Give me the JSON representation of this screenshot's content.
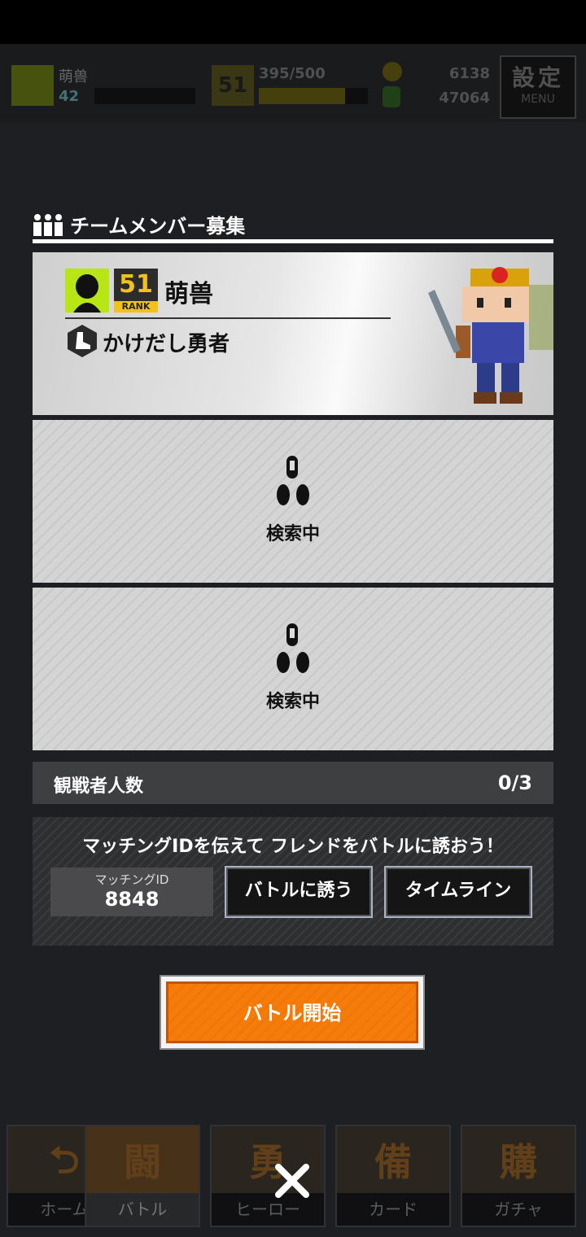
{
  "topbar": {
    "player_name": "萌兽",
    "level": "42",
    "rank": "51",
    "rank_label": "RANK",
    "exp_text": "395/500",
    "exp_fraction": 0.79,
    "coins": "6138",
    "gems": "47064",
    "settings_label": "設定",
    "settings_sub": "MENU"
  },
  "panel": {
    "title": "チームメンバー募集"
  },
  "leader": {
    "rank": "51",
    "rank_label": "RANK",
    "name": "萌兽",
    "title": "かけだし勇者"
  },
  "slots": [
    {
      "status": "検索中"
    },
    {
      "status": "検索中"
    }
  ],
  "spectators": {
    "label": "観戦者人数",
    "count": "0/3"
  },
  "invite": {
    "message": "マッチングIDを伝えて フレンドをバトルに誘おう！",
    "id_label": "マッチングID",
    "id_value": "8848",
    "invite_button": "バトルに誘う",
    "timeline_button": "タイムライン"
  },
  "start_button": "バトル開始",
  "nav": [
    {
      "glyph": "⮌",
      "label": "ホーム"
    },
    {
      "glyph": "闘",
      "label": "バトル"
    },
    {
      "glyph": "勇",
      "label": "ヒーロー"
    },
    {
      "glyph": "備",
      "label": "カード"
    },
    {
      "glyph": "購",
      "label": "ガチャ"
    }
  ],
  "colors": {
    "accent_orange": "#f57c0a",
    "rank_gold": "#f2c21a",
    "avatar_green": "#b7e614"
  }
}
